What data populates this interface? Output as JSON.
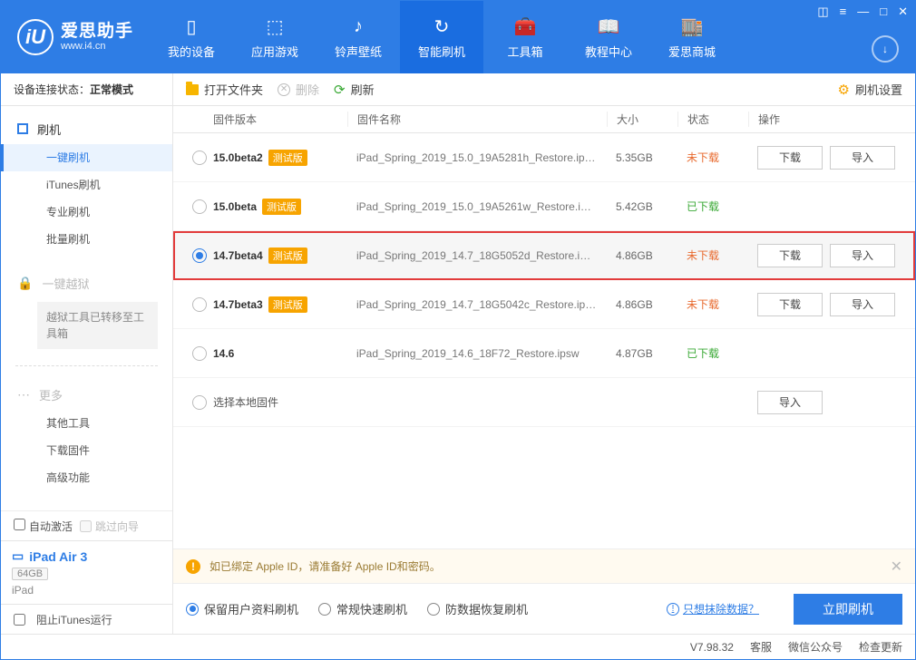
{
  "app": {
    "name": "爱思助手",
    "url": "www.i4.cn"
  },
  "nav": [
    {
      "label": "我的设备",
      "icon": "phone"
    },
    {
      "label": "应用游戏",
      "icon": "apps"
    },
    {
      "label": "铃声壁纸",
      "icon": "music"
    },
    {
      "label": "智能刷机",
      "icon": "refresh",
      "active": true
    },
    {
      "label": "工具箱",
      "icon": "toolbox"
    },
    {
      "label": "教程中心",
      "icon": "book"
    },
    {
      "label": "爱思商城",
      "icon": "store"
    }
  ],
  "sidebar": {
    "conn_label": "设备连接状态：",
    "conn_value": "正常模式",
    "sec_flash": "刷机",
    "items_flash": [
      "一键刷机",
      "iTunes刷机",
      "专业刷机",
      "批量刷机"
    ],
    "sec_jb": "一键越狱",
    "jb_note": "越狱工具已转移至工具箱",
    "sec_more": "更多",
    "items_more": [
      "其他工具",
      "下载固件",
      "高级功能"
    ],
    "auto_activate": "自动激活",
    "skip_guide": "跳过向导",
    "device_name": "iPad Air 3",
    "device_storage": "64GB",
    "device_type": "iPad",
    "block_itunes": "阻止iTunes运行"
  },
  "toolbar": {
    "open": "打开文件夹",
    "delete": "删除",
    "refresh": "刷新",
    "settings": "刷机设置"
  },
  "columns": {
    "version": "固件版本",
    "name": "固件名称",
    "size": "大小",
    "status": "状态",
    "ops": "操作"
  },
  "status_text": {
    "not_downloaded": "未下载",
    "downloaded": "已下载"
  },
  "btn": {
    "download": "下载",
    "import": "导入"
  },
  "beta_tag": "测试版",
  "rows": [
    {
      "version": "15.0beta2",
      "beta": true,
      "name": "iPad_Spring_2019_15.0_19A5281h_Restore.ip…",
      "size": "5.35GB",
      "status": "not_downloaded",
      "ops": [
        "download",
        "import"
      ],
      "selected": false
    },
    {
      "version": "15.0beta",
      "beta": true,
      "name": "iPad_Spring_2019_15.0_19A5261w_Restore.i…",
      "size": "5.42GB",
      "status": "downloaded",
      "ops": [],
      "selected": false
    },
    {
      "version": "14.7beta4",
      "beta": true,
      "name": "iPad_Spring_2019_14.7_18G5052d_Restore.i…",
      "size": "4.86GB",
      "status": "not_downloaded",
      "ops": [
        "download",
        "import"
      ],
      "selected": true,
      "highlight": true
    },
    {
      "version": "14.7beta3",
      "beta": true,
      "name": "iPad_Spring_2019_14.7_18G5042c_Restore.ip…",
      "size": "4.86GB",
      "status": "not_downloaded",
      "ops": [
        "download",
        "import"
      ],
      "selected": false
    },
    {
      "version": "14.6",
      "beta": false,
      "name": "iPad_Spring_2019_14.6_18F72_Restore.ipsw",
      "size": "4.87GB",
      "status": "downloaded",
      "ops": [],
      "selected": false
    }
  ],
  "local_row": "选择本地固件",
  "warn": "如已绑定 Apple ID，请准备好 Apple ID和密码。",
  "flash_opts": [
    "保留用户资料刷机",
    "常规快速刷机",
    "防数据恢复刷机"
  ],
  "flash_opts_checked": 0,
  "erase_link": "只想抹除数据？",
  "flash_btn": "立即刷机",
  "status": {
    "version": "V7.98.32",
    "service": "客服",
    "wechat": "微信公众号",
    "update": "检查更新"
  }
}
